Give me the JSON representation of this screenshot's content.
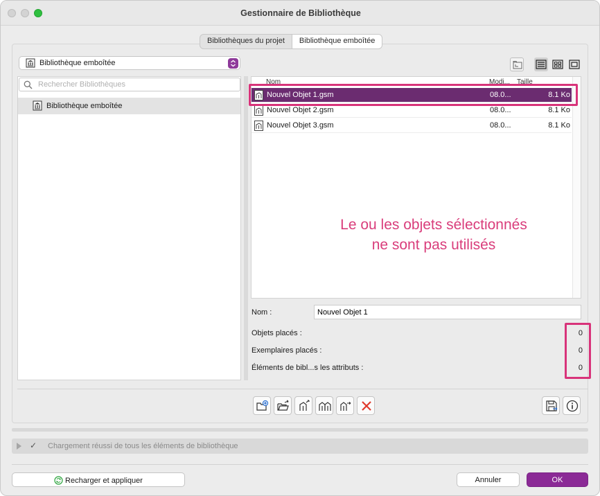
{
  "window": {
    "title": "Gestionnaire de Bibliothèque"
  },
  "tabs": [
    {
      "label": "Bibliothèques du projet",
      "active": false
    },
    {
      "label": "Bibliothèque emboîtée",
      "active": true
    }
  ],
  "library_select": {
    "value": "Bibliothèque emboîtée",
    "icon": "library-icon"
  },
  "search": {
    "placeholder": "Rechercher Bibliothèques",
    "icon": "search-icon"
  },
  "tree": {
    "items": [
      {
        "label": "Bibliothèque emboîtée",
        "icon": "library-icon",
        "selected": true
      }
    ]
  },
  "view_buttons": [
    {
      "name": "browse-folder-icon"
    },
    {
      "name": "list-view-icon",
      "active": true
    },
    {
      "name": "grid-view-icon"
    },
    {
      "name": "single-view-icon"
    }
  ],
  "file_list": {
    "columns": [
      "Nom",
      "Modi...",
      "Taille"
    ],
    "rows": [
      {
        "name": "Nouvel Objet 1.gsm",
        "modified": "08.0...",
        "size": "8.1 Ko",
        "selected": true
      },
      {
        "name": "Nouvel Objet 2.gsm",
        "modified": "08.0...",
        "size": "8.1 Ko",
        "selected": false
      },
      {
        "name": "Nouvel Objet 3.gsm",
        "modified": "08.0...",
        "size": "8.1 Ko",
        "selected": false
      }
    ]
  },
  "message": {
    "line1": "Le ou les objets sélectionnés",
    "line2": "ne sont pas utilisés",
    "color": "#d93d7b"
  },
  "details": {
    "name_label": "Nom :",
    "name_value": "Nouvel Objet 1",
    "stats": [
      {
        "label": "Objets placés :",
        "value": "0"
      },
      {
        "label": "Exemplaires placés :",
        "value": "0"
      },
      {
        "label": "Éléments de bibl...s les attributs :",
        "value": "0"
      }
    ]
  },
  "toolbar": {
    "buttons": [
      {
        "name": "new-folder-icon"
      },
      {
        "name": "open-folder-icon"
      },
      {
        "name": "export-object-icon"
      },
      {
        "name": "duplicate-objects-icon"
      },
      {
        "name": "move-object-icon"
      },
      {
        "name": "delete-icon"
      },
      {
        "name": "save-icon"
      },
      {
        "name": "info-icon"
      }
    ]
  },
  "status": {
    "text": "Chargement réussi de tous les éléments de bibliothèque"
  },
  "footer": {
    "reload_label": "Recharger et appliquer",
    "cancel_label": "Annuler",
    "ok_label": "OK"
  },
  "colors": {
    "accent": "#8b2a96",
    "selection": "#6b2c70",
    "highlight": "#d8337a"
  }
}
